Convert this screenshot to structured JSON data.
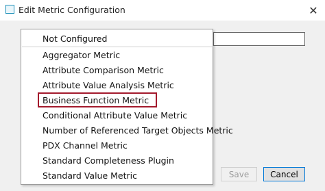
{
  "window": {
    "title": "Edit Metric Configuration",
    "close_glyph": "✕",
    "icon": "window-app-icon"
  },
  "buttons": {
    "save_label": "Save",
    "cancel_label": "Cancel"
  },
  "dropdown": {
    "items": [
      "Not Configured",
      "Aggregator Metric",
      "Attribute Comparison Metric",
      "Attribute Value Analysis Metric",
      "Business Function Metric",
      "Conditional Attribute Value Metric",
      "Number of Referenced Target Objects Metric",
      "PDX Channel Metric",
      "Standard Completeness Plugin",
      "Standard Value Metric"
    ],
    "highlighted_item": "Business Function Metric",
    "highlight_color": "#a3192c"
  }
}
